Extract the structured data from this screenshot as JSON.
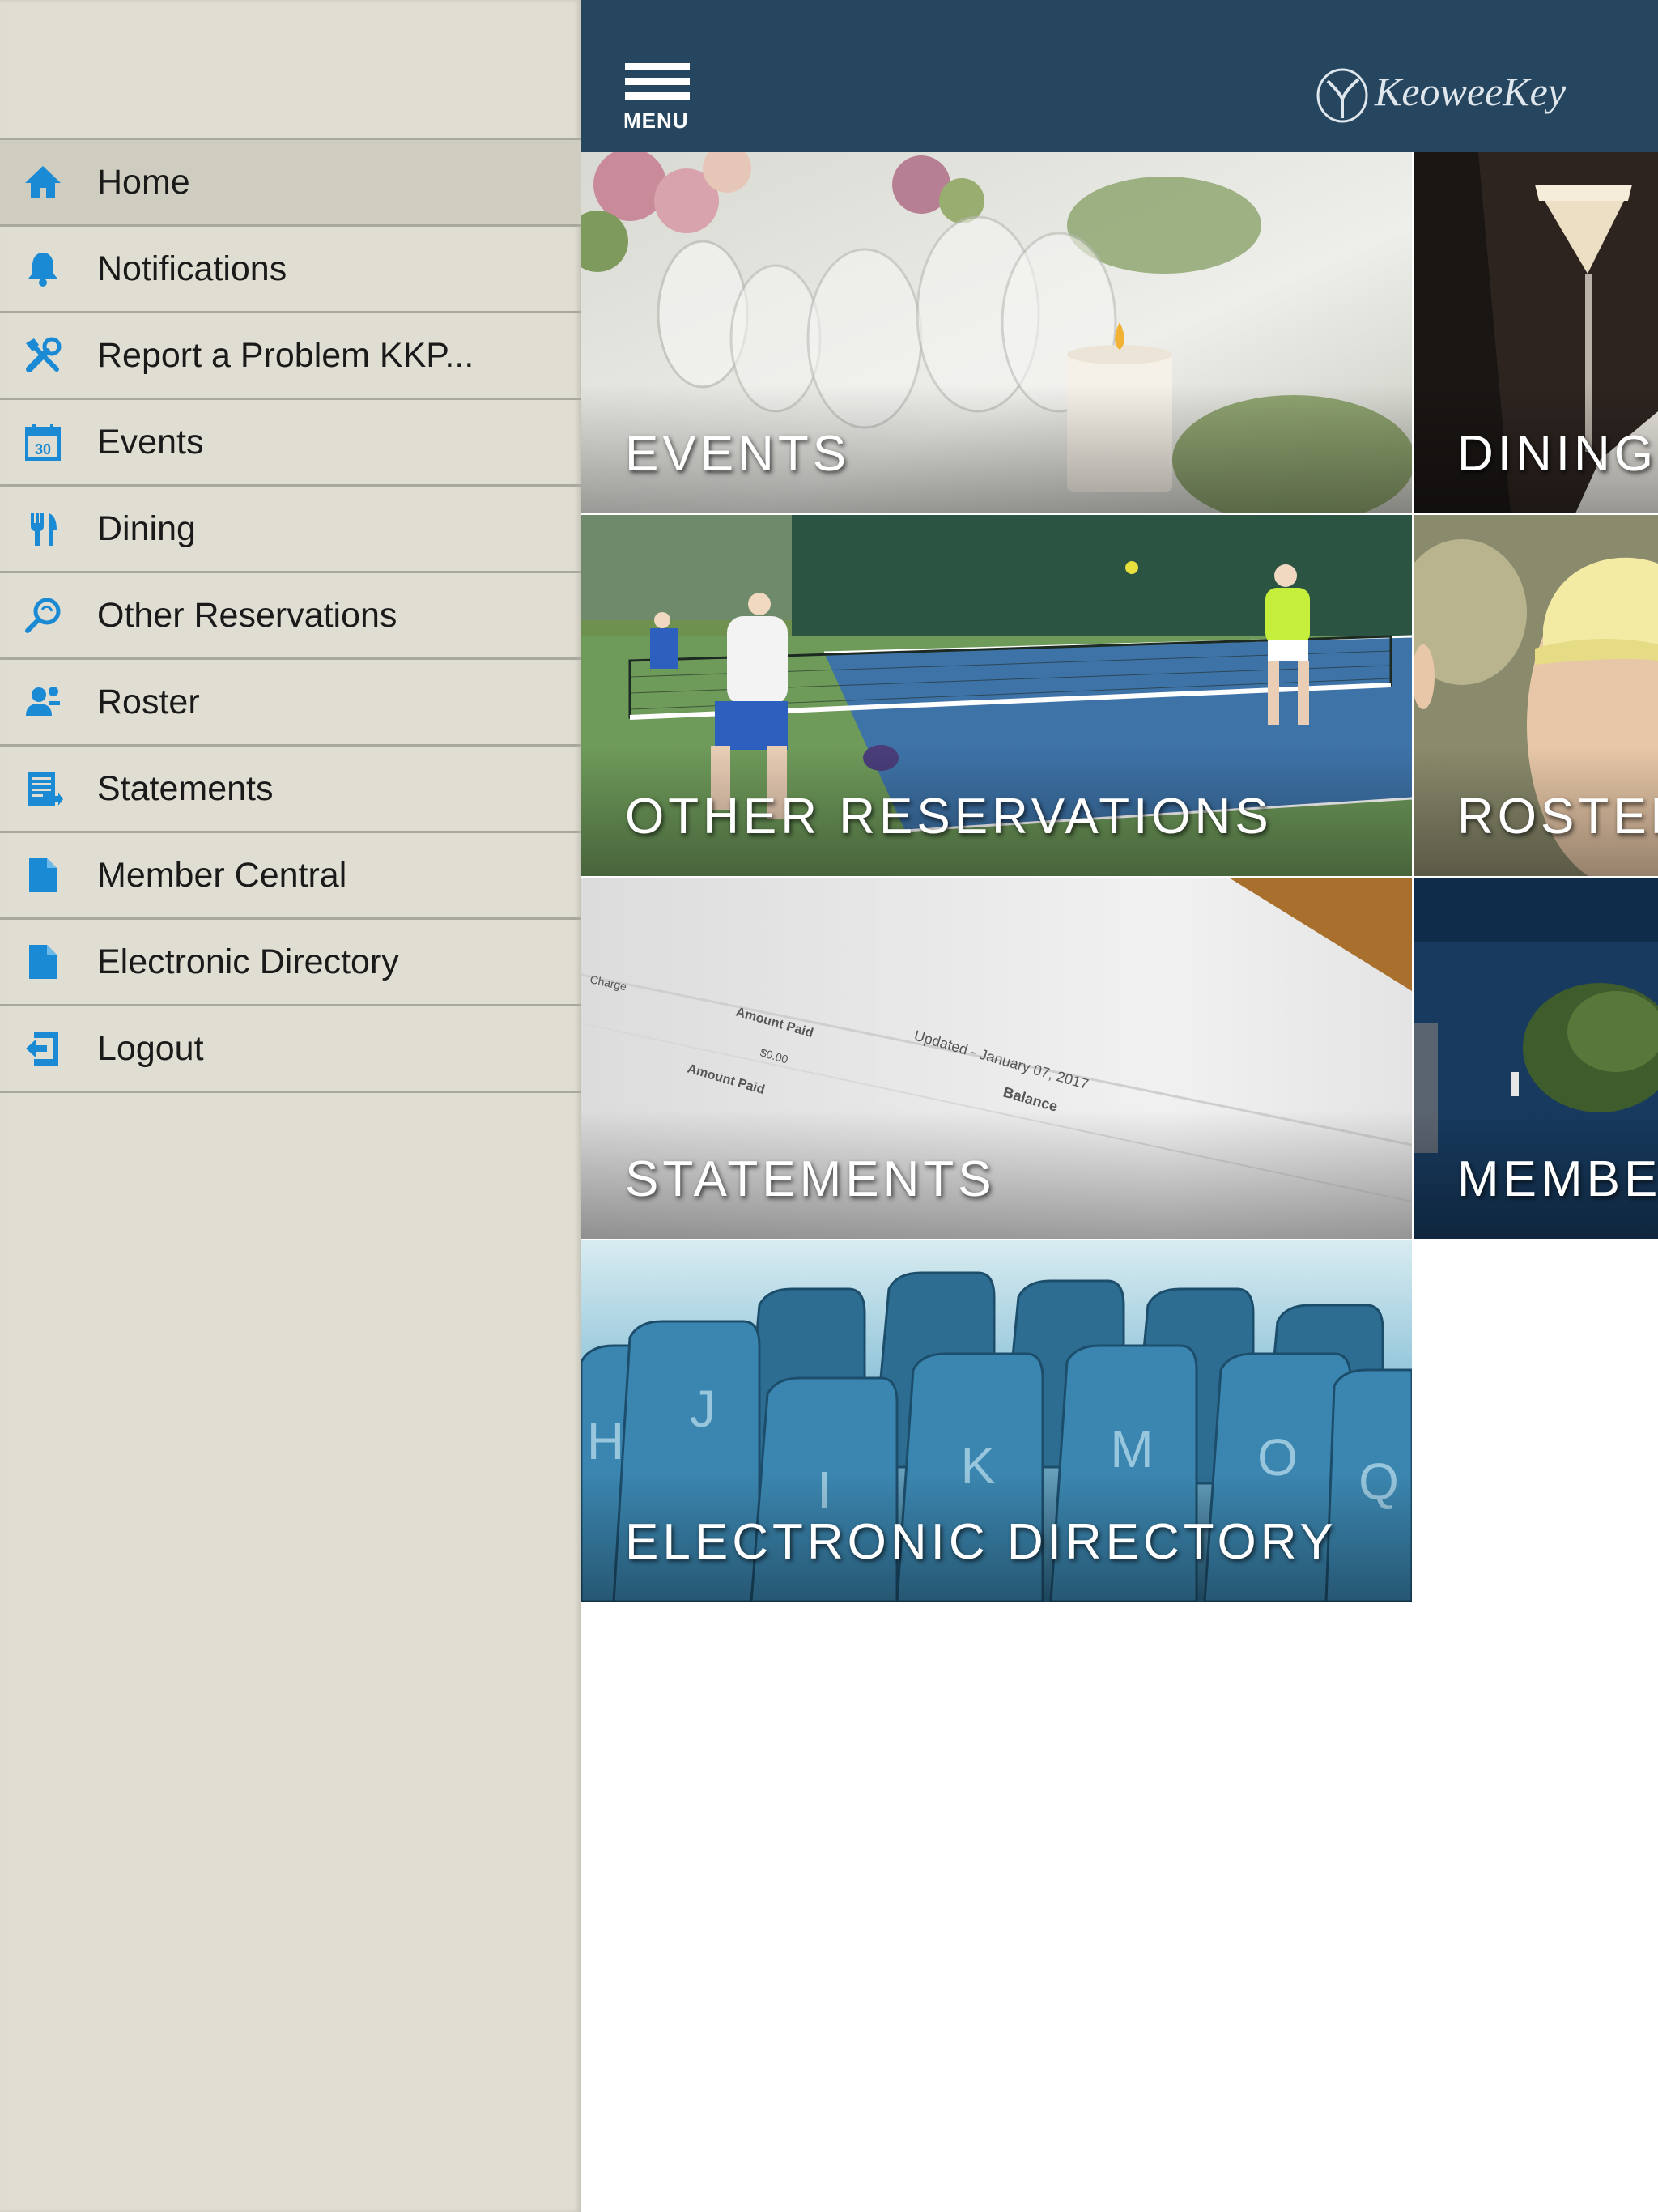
{
  "drawer": {
    "items": [
      {
        "label": "Home",
        "icon": "home-icon",
        "active": true
      },
      {
        "label": "Notifications",
        "icon": "bell-icon"
      },
      {
        "label": "Report a Problem KKP...",
        "icon": "tools-icon"
      },
      {
        "label": "Events",
        "icon": "calendar-icon"
      },
      {
        "label": "Dining",
        "icon": "fork-knife-icon"
      },
      {
        "label": "Other Reservations",
        "icon": "reservation-icon"
      },
      {
        "label": "Roster",
        "icon": "person-icon"
      },
      {
        "label": "Statements",
        "icon": "statement-icon"
      },
      {
        "label": "Member Central",
        "icon": "document-icon"
      },
      {
        "label": "Electronic Directory",
        "icon": "document-icon"
      },
      {
        "label": "Logout",
        "icon": "logout-icon"
      }
    ],
    "calendar_day": "30"
  },
  "header": {
    "menu_label": "MENU",
    "logo_text": "KeoweeKey",
    "background": "#264660"
  },
  "tiles": {
    "events": "EVENTS",
    "dining": "DINING",
    "other_reservations": "OTHER RESERVATIONS",
    "roster": "ROSTER",
    "statements": "STATEMENTS",
    "member_central": "MEMBER CENTRAL",
    "electronic_directory": "ELECTRONIC DIRECTORY"
  },
  "statement_doc": {
    "charge": "Charge",
    "amount_paid": "Amount Paid",
    "amount_value": "$0.00",
    "updated": "Updated - January 07, 2017",
    "balance": "Balance"
  },
  "directory_tabs": [
    "H",
    "J",
    "I",
    "K",
    "M",
    "O",
    "Q"
  ],
  "colors": {
    "accent": "#1a8ad4",
    "drawer_bg": "#e0ded2",
    "drawer_active": "#cfcdbf"
  }
}
